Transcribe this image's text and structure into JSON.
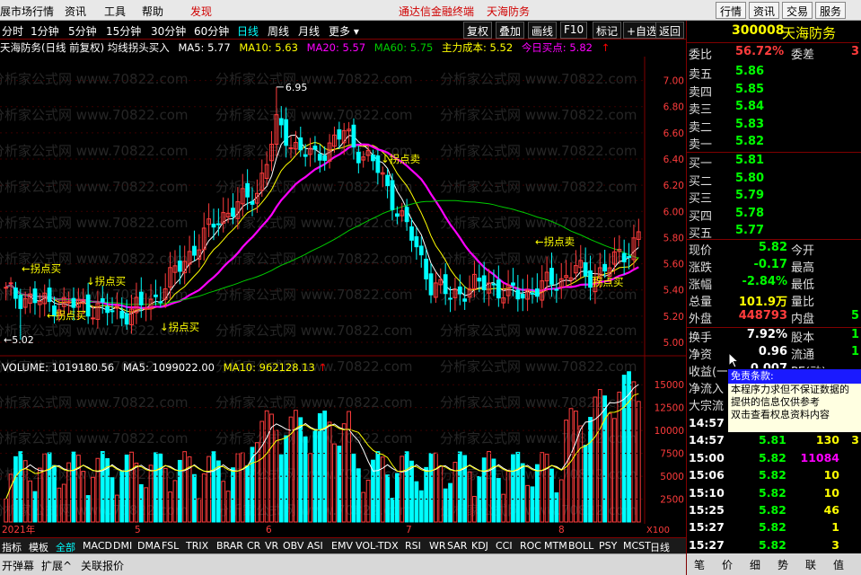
{
  "menu": {
    "items": [
      "展市场行情",
      "资讯",
      "工具",
      "帮助",
      "发现"
    ],
    "brand": "通达信金融终端",
    "stock_name": "天海防务",
    "right_buttons": [
      "行情",
      "资讯",
      "交易",
      "服务"
    ]
  },
  "periods": [
    "分时",
    "1分钟",
    "5分钟",
    "15分钟",
    "30分钟",
    "60分钟",
    "日线",
    "周线",
    "月线",
    "更多"
  ],
  "tools": [
    "复权",
    "叠加",
    "画线",
    "F10",
    "标记",
    "+自选",
    "返回"
  ],
  "info": {
    "title": "天海防务(日线 前复权) 均线拐头买入",
    "ma5": "MA5: 5.77",
    "ma10": "MA10: 5.63",
    "ma20": "MA20: 5.57",
    "ma60": "MA60: 5.75",
    "cost": "主力成本: 5.52",
    "buy": "今日买点: 5.82",
    "arrow": "↑"
  },
  "chart_data": {
    "type": "candlestick",
    "ylim": [
      5.0,
      7.1
    ],
    "y_ticks": [
      "7.00",
      "6.80",
      "6.60",
      "6.40",
      "6.20",
      "6.00",
      "5.80",
      "5.60",
      "5.40",
      "5.20",
      "5.00"
    ],
    "high_label": "6.95",
    "low_label": "5.02",
    "annotations": [
      "←拐点买",
      "↓拐点买",
      "←拐点买",
      "↓拐点卖",
      "←拐点卖",
      "↓拐点买",
      "拐点买"
    ],
    "volume": {
      "header": "VOLUME: 1019180.56",
      "ma5": "MA5: 1099022.00",
      "ma10": "MA10: 962128.13",
      "y_ticks": [
        "15000",
        "12500",
        "10000",
        "7500",
        "5000",
        "2500"
      ],
      "unit": "X100"
    },
    "x_labels": [
      "2021年",
      "5",
      "6",
      "7",
      "8"
    ],
    "period_label": "日线"
  },
  "quote": {
    "code": "300008",
    "name": "天海防务",
    "weibi_label": "委比",
    "weibi": "56.72%",
    "weicha_label": "委差",
    "weicha": "3",
    "sell": [
      [
        "卖五",
        "5.86"
      ],
      [
        "卖四",
        "5.85"
      ],
      [
        "卖三",
        "5.84"
      ],
      [
        "卖二",
        "5.83"
      ],
      [
        "卖一",
        "5.82"
      ]
    ],
    "buy": [
      [
        "买一",
        "5.81"
      ],
      [
        "买二",
        "5.80"
      ],
      [
        "买三",
        "5.79"
      ],
      [
        "买四",
        "5.78"
      ],
      [
        "买五",
        "5.77"
      ]
    ],
    "stats": [
      [
        "现价",
        "5.82",
        "今开",
        ""
      ],
      [
        "涨跌",
        "-0.17",
        "最高",
        ""
      ],
      [
        "涨幅",
        "-2.84%",
        "最低",
        ""
      ],
      [
        "总量",
        "101.9万",
        "量比",
        ""
      ],
      [
        "外盘",
        "448793",
        "内盘",
        "5"
      ],
      [
        "换手",
        "7.92%",
        "股本",
        "1"
      ],
      [
        "净资",
        "0.96",
        "流通",
        "1"
      ],
      [
        "收益(一",
        "0.007",
        "PE(动)",
        ""
      ],
      [
        "净流入",
        "",
        "",
        ""
      ],
      [
        "大宗流",
        "",
        "",
        ""
      ]
    ],
    "ticks": [
      [
        "14:57",
        "5.81",
        "",
        ""
      ],
      [
        "14:57",
        "5.81",
        "130",
        "3"
      ],
      [
        "15:00",
        "5.82",
        "11084",
        ""
      ],
      [
        "15:06",
        "5.82",
        "10",
        ""
      ],
      [
        "15:10",
        "5.82",
        "10",
        ""
      ],
      [
        "15:25",
        "5.82",
        "46",
        ""
      ],
      [
        "15:27",
        "5.82",
        "1",
        ""
      ],
      [
        "15:27",
        "5.82",
        "3",
        ""
      ]
    ],
    "tabs": [
      "笔",
      "价",
      "细",
      "势",
      "联",
      "值"
    ]
  },
  "popup": {
    "title": "免责条款:",
    "lines": [
      "本程序力求但不保证数据的",
      "提供的信息仅供参考",
      "双击查看权息资料内容"
    ]
  },
  "indicators": [
    "指标",
    "模板",
    "全部",
    "MACD",
    "DMI",
    "DMA",
    "FSL",
    "TRIX",
    "BRAR",
    "CR",
    "VR",
    "OBV",
    "ASI",
    "EMV",
    "VOL-TDX",
    "RSI",
    "WR",
    "SAR",
    "KDJ",
    "CCI",
    "ROC",
    "MTM",
    "BOLL",
    "PSY",
    "MCST"
  ],
  "status": [
    "开弹幕",
    "扩展^",
    "关联报价"
  ],
  "watermark": "分析家公式网 www.70822.com",
  "colors": {
    "up": "#ff3c3c",
    "down": "#00ffff",
    "ma5": "#ffffff",
    "ma10": "#ffff00",
    "ma20": "#ff00ff",
    "ma60": "#00cc00",
    "accent": "#ff0000"
  }
}
